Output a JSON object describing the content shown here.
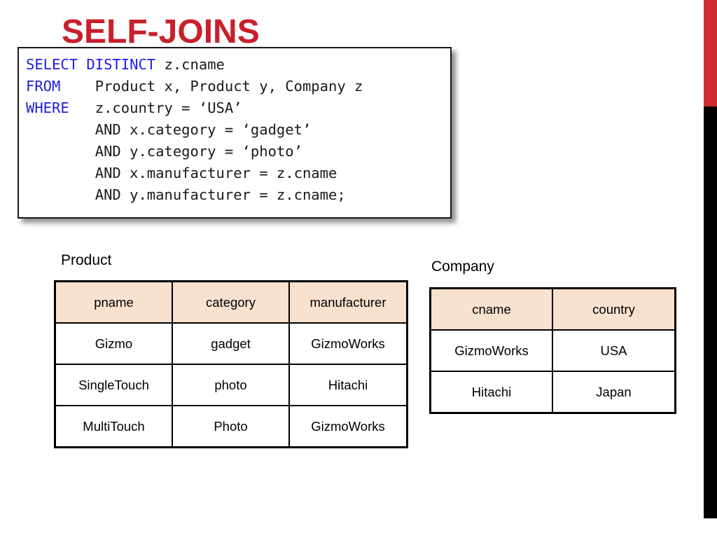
{
  "slide": {
    "title": "SELF-JOINS"
  },
  "code_block": {
    "lines": [
      {
        "keyword": "SELECT DISTINCT",
        "rest": " z.cname"
      },
      {
        "keyword": "FROM",
        "rest": "    Product x, Product y, Company z"
      },
      {
        "keyword": "WHERE",
        "rest": "   z.country = ‘USA’"
      },
      {
        "keyword": "",
        "rest": "        AND x.category = ‘gadget’"
      },
      {
        "keyword": "",
        "rest": "        AND y.category = ‘photo’"
      },
      {
        "keyword": "",
        "rest": "        AND x.manufacturer = z.cname"
      },
      {
        "keyword": "",
        "rest": "        AND y.manufacturer = z.cname;"
      }
    ]
  },
  "product_table": {
    "caption": "Product",
    "columns": [
      "pname",
      "category",
      "manufacturer"
    ],
    "rows": [
      [
        "Gizmo",
        "gadget",
        "GizmoWorks"
      ],
      [
        "SingleTouch",
        "photo",
        "Hitachi"
      ],
      [
        "MultiTouch",
        "Photo",
        "GizmoWorks"
      ]
    ]
  },
  "company_table": {
    "caption": "Company",
    "columns": [
      "cname",
      "country"
    ],
    "rows": [
      [
        "GizmoWorks",
        "USA"
      ],
      [
        "Hitachi",
        "Japan"
      ]
    ]
  },
  "decor": {
    "bar_red_color": "#D12B2F",
    "bar_black_color": "#000000",
    "title_color": "#C8202B",
    "keyword_color": "#2020E0",
    "header_fill": "#F9E1D0"
  }
}
